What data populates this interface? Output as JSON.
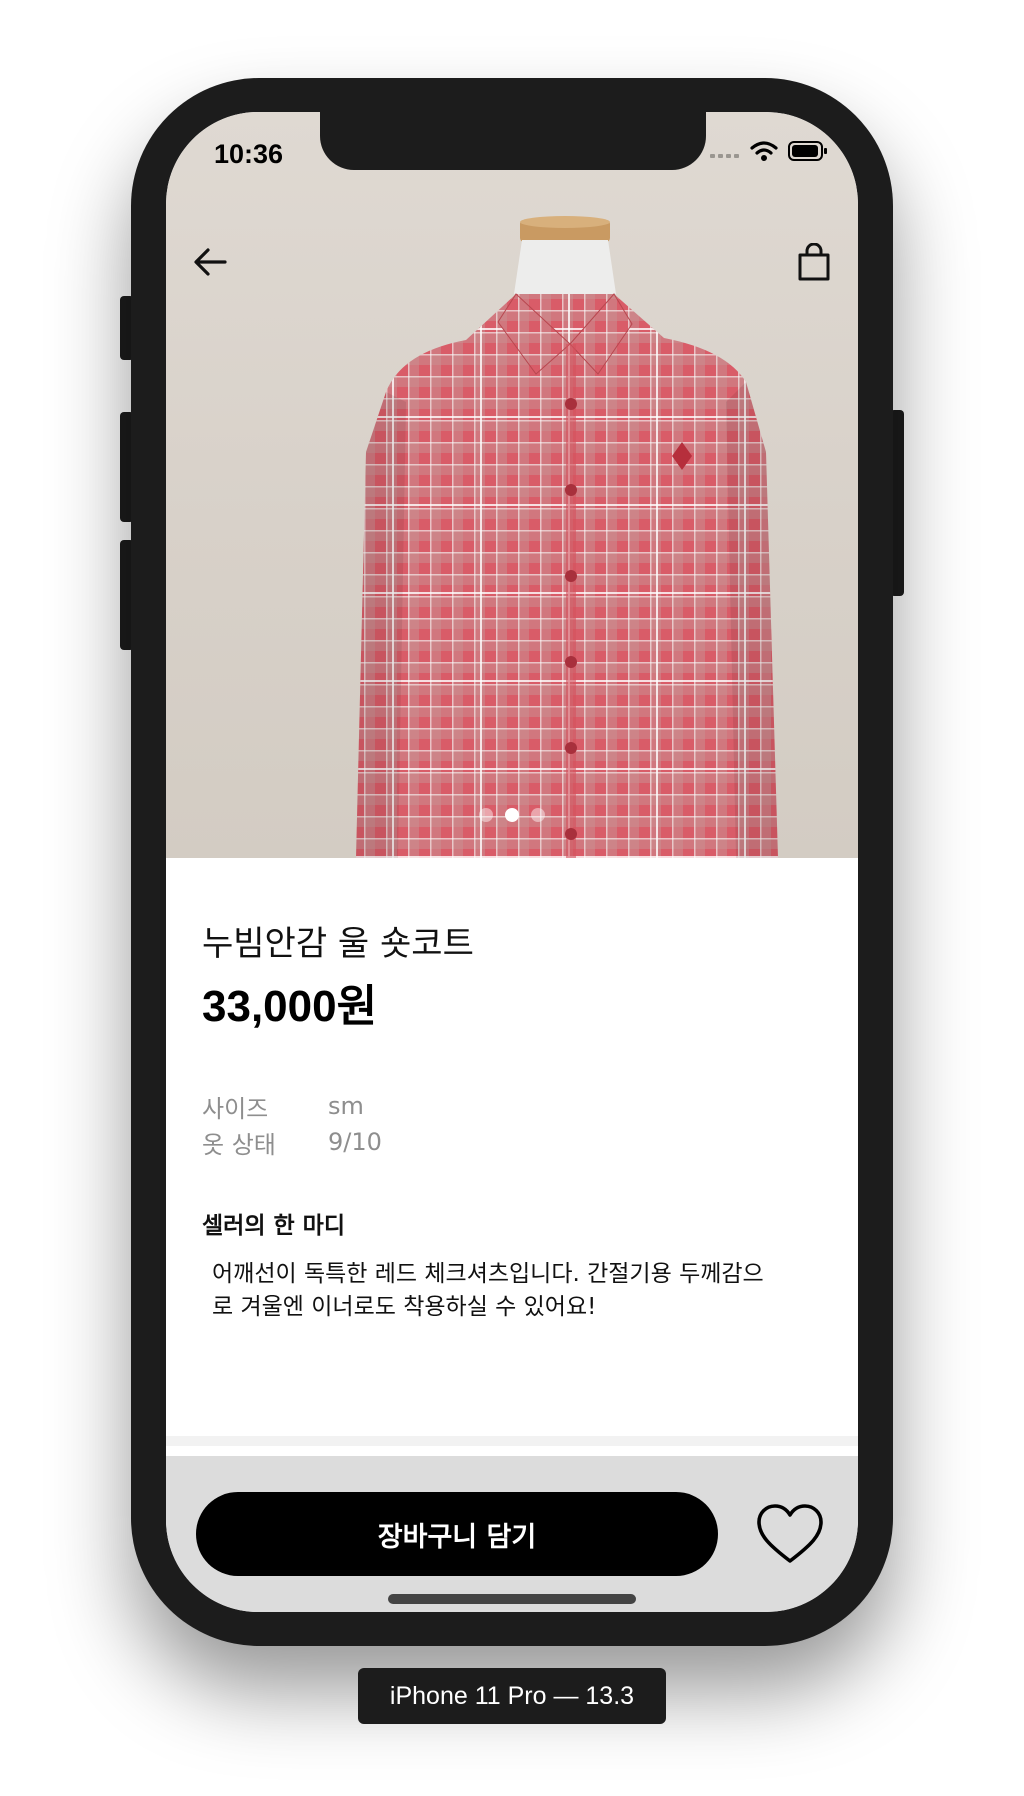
{
  "status_bar": {
    "time": "10:36"
  },
  "header": {
    "back_icon": "arrow-left-icon",
    "bag_icon": "shopping-bag-icon"
  },
  "gallery": {
    "image_count": 3,
    "active_index": 1
  },
  "product": {
    "name": "누빔안감 울 숏코트",
    "price": "33,000원"
  },
  "specs": [
    {
      "label": "사이즈",
      "value": "sm"
    },
    {
      "label": "옷 상태",
      "value": "9/10"
    }
  ],
  "seller": {
    "title": "셀러의 한 마디",
    "line1": "어깨선이 독특한 레드 체크셔츠입니다. 간절기용 두께감으",
    "line2": "로 겨울엔 이너로도 착용하실 수 있어요!"
  },
  "actions": {
    "cart_label": "장바구니 담기",
    "favorite_icon": "heart-icon"
  },
  "device": {
    "caption": "iPhone 11 Pro — 13.3"
  },
  "colors": {
    "shirt": "#d85a66",
    "background": "#dcd6ce",
    "button": "#000000",
    "bottom_bar": "#dcdcdc"
  }
}
